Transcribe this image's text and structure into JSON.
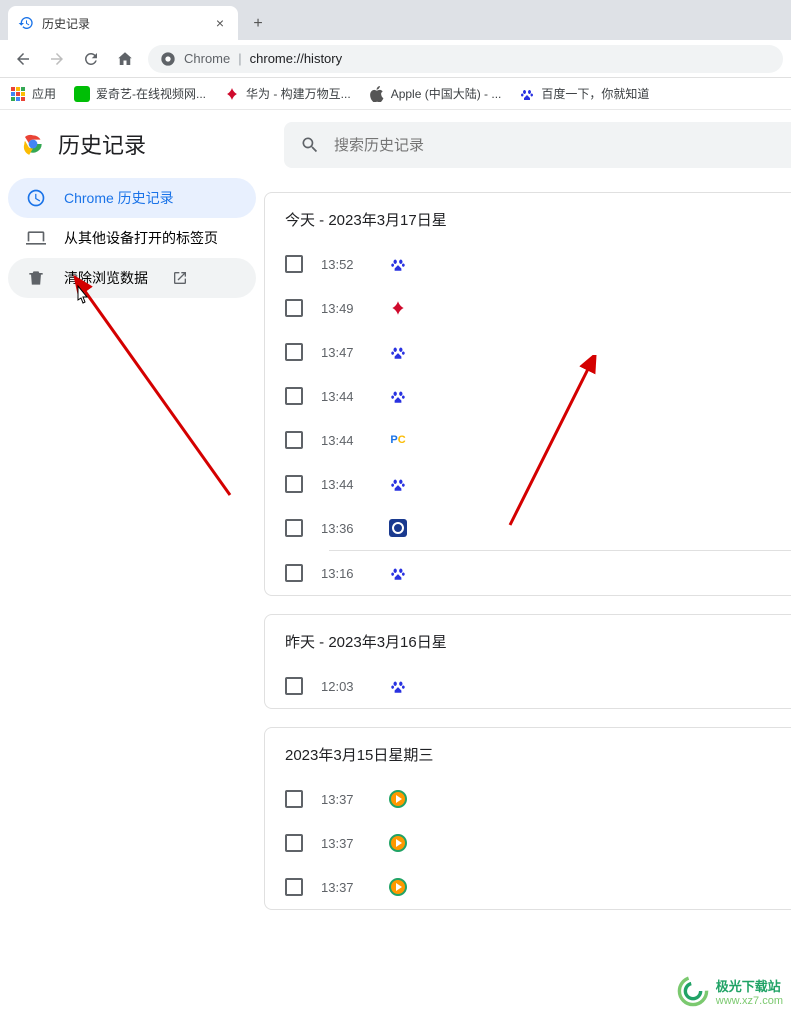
{
  "tab": {
    "title": "历史记录"
  },
  "toolbar": {
    "addr_prefix": "Chrome",
    "addr_path": "chrome://history"
  },
  "bookmarks": {
    "apps": "应用",
    "iqiyi": "爱奇艺-在线视频网...",
    "huawei": "华为 - 构建万物互...",
    "apple": "Apple (中国大陆) - ...",
    "baidu": "百度一下，你就知道"
  },
  "sidebar": {
    "title": "历史记录",
    "chrome_history": "Chrome 历史记录",
    "other_devices": "从其他设备打开的标签页",
    "clear_data": "清除浏览数据"
  },
  "search": {
    "placeholder": "搜索历史记录"
  },
  "groups": [
    {
      "header": "今天 - 2023年3月17日星",
      "items": [
        {
          "time": "13:52",
          "icon": "baidu"
        },
        {
          "time": "13:49",
          "icon": "huawei"
        },
        {
          "time": "13:47",
          "icon": "baidu"
        },
        {
          "time": "13:44",
          "icon": "baidu"
        },
        {
          "time": "13:44",
          "icon": "pc"
        },
        {
          "time": "13:44",
          "icon": "baidu"
        },
        {
          "time": "13:36",
          "icon": "blue"
        },
        {
          "time": "13:16",
          "icon": "baidu",
          "divider_before": true
        }
      ]
    },
    {
      "header": "昨天 - 2023年3月16日星",
      "items": [
        {
          "time": "12:03",
          "icon": "baidu"
        }
      ]
    },
    {
      "header": "2023年3月15日星期三",
      "items": [
        {
          "time": "13:37",
          "icon": "green"
        },
        {
          "time": "13:37",
          "icon": "green"
        },
        {
          "time": "13:37",
          "icon": "green"
        }
      ]
    }
  ],
  "watermark": {
    "top": "极光下载站",
    "bottom": "www.xz7.com"
  }
}
